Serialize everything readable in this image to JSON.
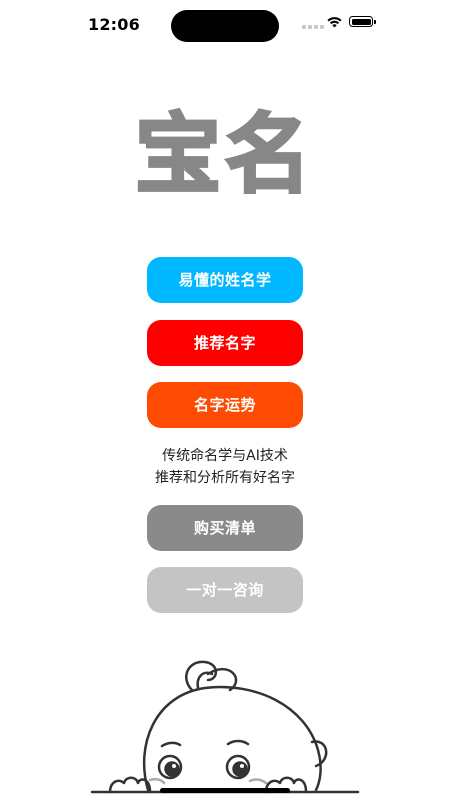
{
  "status_bar": {
    "time": "12:06",
    "icons": [
      "signal-icon",
      "wifi-icon",
      "battery-icon"
    ]
  },
  "logo": {
    "text": "宝名",
    "color": "#878787"
  },
  "buttons": [
    {
      "label": "易懂的姓名学",
      "color": "#00b8ff"
    },
    {
      "label": "推荐名字",
      "color": "#fe0000"
    },
    {
      "label": "名字运势",
      "color": "#fe4a02"
    },
    {
      "label": "购买清单",
      "color": "#8a8a8a"
    },
    {
      "label": "一对一咨询",
      "color": "#c4c4c4"
    }
  ],
  "tagline": {
    "line1": "传统命名学与AI技术",
    "line2": "推荐和分析所有好名字"
  },
  "illustration": {
    "icon": "baby-peeking-icon"
  }
}
